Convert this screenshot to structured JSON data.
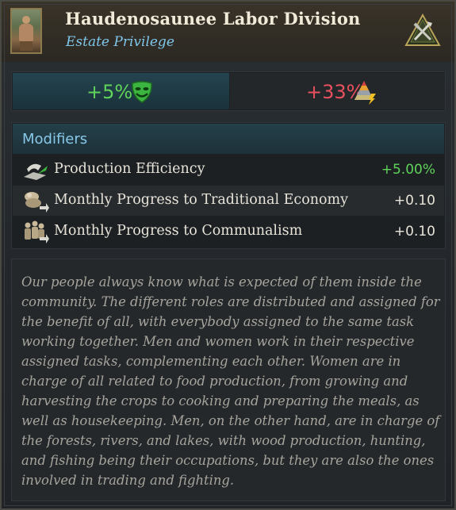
{
  "header": {
    "title": "Haudenosaunee Labor Division",
    "subtitle": "Estate Privilege",
    "portrait_icon": "native-worker-portrait",
    "estate_icon": "crossed-tools-estate-icon"
  },
  "stats": {
    "satisfaction": {
      "value": "+5%",
      "icon": "green-mask-icon",
      "color": "#5fd35a"
    },
    "power": {
      "value": "+33%",
      "icon": "estate-power-pyramid-icon",
      "color": "#e8505e"
    }
  },
  "modifiers": {
    "heading": "Modifiers",
    "items": [
      {
        "icon": "production-efficiency-icon",
        "label": "Production Efficiency",
        "value": "+5.00%",
        "color": "#5fd35a"
      },
      {
        "icon": "traditional-economy-icon",
        "label": "Monthly Progress to Traditional Economy",
        "value": "+0.10",
        "color": "#e8e4da"
      },
      {
        "icon": "communalism-icon",
        "label": "Monthly Progress to Communalism",
        "value": "+0.10",
        "color": "#e8e4da"
      }
    ]
  },
  "description": "Our people always know what is expected of them inside the community. The different roles are distributed and assigned for the benefit of all, with everybody assigned to the same task working together. Men and women work in their respective assigned tasks, complementing each other. Women are in charge of all related to food production, from growing and harvesting the crops to cooking and preparing the meals, as well as housekeeping. Men, on the other hand, are in charge of the forests, rivers, and lakes, with wood production, hunting, and fishing being their occupations, but they are also the ones involved in trading and fighting."
}
